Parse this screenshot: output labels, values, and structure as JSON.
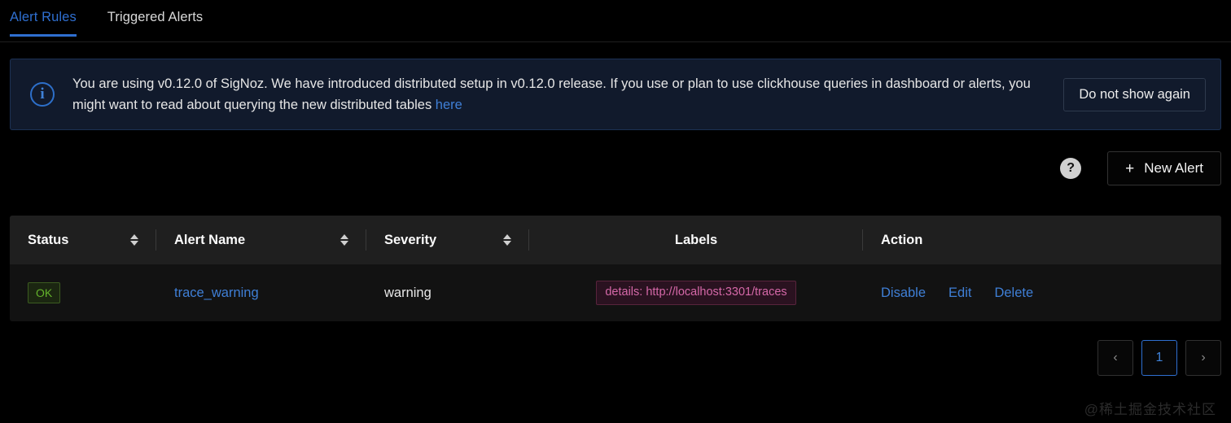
{
  "tabs": [
    {
      "label": "Alert Rules",
      "active": true
    },
    {
      "label": "Triggered Alerts",
      "active": false
    }
  ],
  "banner": {
    "icon": "info-circle-icon",
    "text_before_link": "You are using v0.12.0 of SigNoz. We have introduced distributed setup in v0.12.0 release. If you use or plan to use clickhouse queries in dashboard or alerts, you might want to read about querying the new distributed tables ",
    "link_label": "here",
    "dismiss_label": "Do not show again"
  },
  "toolbar": {
    "help_icon": "question-mark-icon",
    "help_label": "?",
    "new_alert_icon": "plus-icon",
    "new_alert_plus": "+",
    "new_alert_label": "New Alert"
  },
  "table": {
    "columns": [
      {
        "label": "Status",
        "sortable": true,
        "align": "left"
      },
      {
        "label": "Alert Name",
        "sortable": true,
        "align": "left"
      },
      {
        "label": "Severity",
        "sortable": true,
        "align": "left"
      },
      {
        "label": "Labels",
        "sortable": false,
        "align": "center"
      },
      {
        "label": "Action",
        "sortable": false,
        "align": "left"
      }
    ],
    "rows": [
      {
        "status": "OK",
        "alert_name": "trace_warning",
        "severity": "warning",
        "label_tag": "details: http://localhost:3301/traces",
        "actions": [
          "Disable",
          "Edit",
          "Delete"
        ]
      }
    ]
  },
  "pagination": {
    "prev_label": "‹",
    "next_label": "›",
    "pages": [
      "1"
    ],
    "current": "1"
  },
  "watermark": "@稀土掘金技术社区",
  "colors": {
    "accent_blue": "#2f6fd0",
    "link_blue": "#3f7fd6",
    "status_green": "#64b32b",
    "label_pink": "#d568a8",
    "banner_bg": "#111a2c",
    "page_bg": "#000000",
    "table_header_bg": "#1f1f1f",
    "table_row_bg": "#121212"
  }
}
